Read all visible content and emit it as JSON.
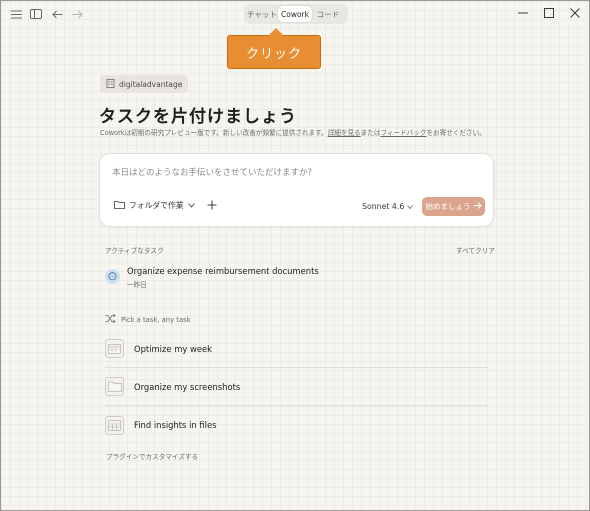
{
  "titlebar": {
    "tabs": [
      {
        "label": "チャット",
        "active": false
      },
      {
        "label": "Cowork",
        "active": true
      },
      {
        "label": "コード",
        "active": false
      }
    ]
  },
  "callout": {
    "label": "クリック",
    "color": "#e98d32"
  },
  "workspace": {
    "name": "digitaladvantage"
  },
  "main": {
    "heading": "タスクを片付けましょう",
    "subtext_pre": "Coworkは初期の研究プレビュー版です。新しい改善が頻繁に提供されます。",
    "subtext_link1": "詳細を見る",
    "subtext_mid": "または",
    "subtext_link2": "フィードバック",
    "subtext_post": "をお寄せください。"
  },
  "composer": {
    "placeholder": "本日はどのようなお手伝いをさせていただけますか？",
    "folder_label": "フォルダで作業",
    "model": "Sonnet 4.6",
    "start_label": "始めましょう",
    "start_color": "#dba58d"
  },
  "active_tasks": {
    "label": "アクティブなタスク",
    "clear_label": "すべてクリア",
    "items": [
      {
        "title": "Organize expense reimbursement documents",
        "time": "一昨日"
      }
    ]
  },
  "suggestions": {
    "pick_label": "Pick a task, any task",
    "items": [
      {
        "label": "Optimize my week",
        "icon": "calendar-icon"
      },
      {
        "label": "Organize my screenshots",
        "icon": "folder-icon"
      },
      {
        "label": "Find insights in files",
        "icon": "spreadsheet-icon"
      }
    ]
  },
  "footer": {
    "plugin_link": "プラグインでカスタマイズする"
  }
}
